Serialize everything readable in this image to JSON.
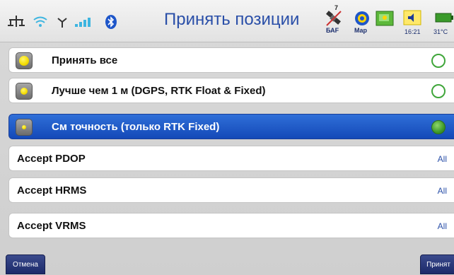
{
  "header": {
    "title": "Принять позиции",
    "satellite_count": "7",
    "satellite_label": "БАF",
    "map_label": "Map",
    "time": "16:21",
    "temperature": "31°C",
    "icons": [
      "network-icon",
      "wifi-icon",
      "antenna-icon",
      "signal-strength-icon",
      "bluetooth-icon",
      "satellite-icon",
      "map-icon",
      "screen-icon",
      "speaker-icon",
      "battery-icon"
    ]
  },
  "options": [
    {
      "label": "Принять все",
      "indicator": "yellow-full",
      "selected": false,
      "checked": false
    },
    {
      "label": "Лучше чем 1 м (DGPS, RTK Float & Fixed)",
      "indicator": "yellow-medium",
      "selected": false,
      "checked": false
    },
    {
      "label": "См точность (только RTK Fixed)",
      "indicator": "yellow-small",
      "selected": true,
      "checked": true
    }
  ],
  "settings": [
    {
      "label": "Accept PDOP",
      "value": "All"
    },
    {
      "label": "Accept HRMS",
      "value": "All"
    },
    {
      "label": "Accept VRMS",
      "value": "All"
    }
  ],
  "footer": {
    "cancel_label": "Отмена",
    "accept_label": "Принят"
  },
  "colors": {
    "title": "#2a4fa8",
    "selected_row": "#1f5cc8",
    "radio_green": "#3fa63a",
    "button_bg": "#26357a"
  }
}
